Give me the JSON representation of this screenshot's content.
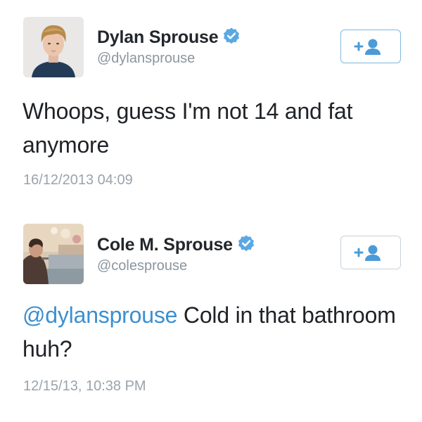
{
  "tweets": [
    {
      "display_name": "Dylan Sprouse",
      "handle": "@dylansprouse",
      "verified": true,
      "text": "Whoops, guess I'm not 14 and fat anymore",
      "timestamp": "16/12/2013 04:09",
      "follow_button_icon": "add-user-icon"
    },
    {
      "display_name": "Cole M. Sprouse",
      "handle": "@colesprouse",
      "verified": true,
      "mention": "@dylansprouse",
      "text": " Cold in that bathroom huh?",
      "timestamp": "12/15/13, 10:38 PM",
      "follow_button_icon": "add-user-icon"
    }
  ],
  "colors": {
    "verified_badge": "#5aa8e4",
    "mention_link": "#3c8fd0",
    "follow_icon": "#4a9bd8",
    "secondary_text": "#8b959e"
  }
}
